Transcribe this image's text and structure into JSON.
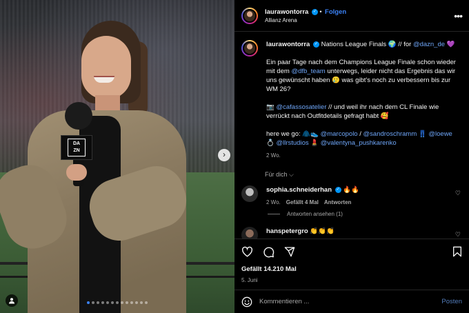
{
  "post": {
    "username": "laurawontorra",
    "follow_label": "Folgen",
    "location": "Allianz Arena",
    "more_label": "•••"
  },
  "caption": {
    "username": "laurawontorra",
    "line1_text": " Nations League Finals 🌍 // for ",
    "line1_link": "@dazn_de",
    "line1_end": " 💜",
    "p2_a": "Ein paar Tage nach dem Champions League Finale schon wieder mit dem ",
    "p2_link": "@dfb_team",
    "p2_b": " unterwegs, leider nicht das Ergebnis das wir uns gewünscht haben 🥲 was gibt's noch zu verbessern bis zur WM 26?",
    "p3_a": "📷 ",
    "p3_link": "@cafassosatelier",
    "p3_b": " // und weil ihr nach dem CL Finale wie verrückt nach Outfitdetails gefragt habt 🥰",
    "p4_a": "here we go: 🧥👟 ",
    "p4_link1": "@marcopolo",
    "p4_sep1": " / ",
    "p4_link2": "@sandroschramm",
    "p4_sep2": " 👖 ",
    "p4_link3": "@loewe",
    "p4_sep3": " 💍 ",
    "p4_link4": "@llrstudios",
    "p4_sep4": " 💄 ",
    "p4_link5": "@valentyna_pushkarenko",
    "age": "2 Wo."
  },
  "translate_label": "Für dich ⌵",
  "comments": [
    {
      "username": "sophia.schneiderhan",
      "text": " 🔥🔥",
      "age": "2 Wo.",
      "likes": "Gefällt 4 Mal",
      "reply_label": "Antworten",
      "view_replies": "Antworten ansehen (1)"
    },
    {
      "username": "hanspetergro",
      "text": " 👏👏👏"
    }
  ],
  "likes_count": "Gefällt 14.210 Mal",
  "post_date": "5. Juni",
  "composer": {
    "placeholder": "Kommentieren ...",
    "post_label": "Posten"
  },
  "media": {
    "mic_brand": "DA\nZN",
    "carousel_count": 13,
    "carousel_active": 0
  },
  "colors": {
    "link": "#6ea5f7",
    "verified": "#0095f6",
    "follow": "#3b82f6",
    "background": "#000000"
  }
}
